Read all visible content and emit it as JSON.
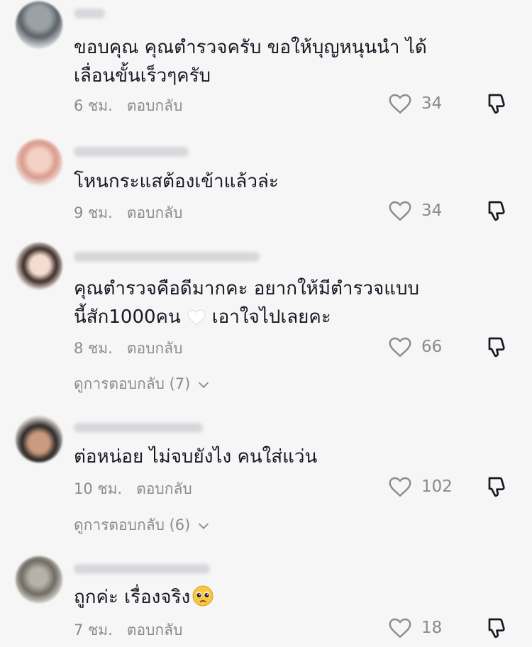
{
  "comments": [
    {
      "text_lines": [
        "ขอบคุณ คุณตำรวจครับ ขอให้บุญหนุนนำ ได้",
        "เลื่อนขั้นเร็วๆครับ"
      ],
      "time": "6 ชม.",
      "reply": "ตอบกลับ",
      "likes": "34"
    },
    {
      "text_lines": [
        "โหนกระแสต้องเข้าแล้วล่ะ"
      ],
      "time": "9 ชม.",
      "reply": "ตอบกลับ",
      "likes": "34"
    },
    {
      "text_lines": [
        "คุณตำรวจคือดีมากคะ อยากให้มีตำรวจแบบ",
        "นี้สัก1000คน",
        "เอาใจไปเลยคะ"
      ],
      "time": "8 ชม.",
      "reply": "ตอบกลับ",
      "likes": "66",
      "view_replies": "ดูการตอบกลับ (7)"
    },
    {
      "text_lines": [
        "ต่อหน่อย ไม่จบยังไง คนใส่แว่น"
      ],
      "time": "10 ชม.",
      "reply": "ตอบกลับ",
      "likes": "102",
      "view_replies": "ดูการตอบกลับ (6)"
    },
    {
      "text_lines": [
        "ถูกค่ะ เรื่องจริง"
      ],
      "time": "7 ชม.",
      "reply": "ตอบกลับ",
      "likes": "18"
    }
  ],
  "icons": {
    "like": "heart-outline-icon",
    "dislike": "thumbs-down-icon",
    "expand": "chevron-down-icon",
    "emoji_1": "white-heart-emoji",
    "emoji_2": "pleading-face-emoji"
  },
  "colors": {
    "background": "#f6f6f6",
    "text": "#161823",
    "muted": "#8a8b91"
  }
}
